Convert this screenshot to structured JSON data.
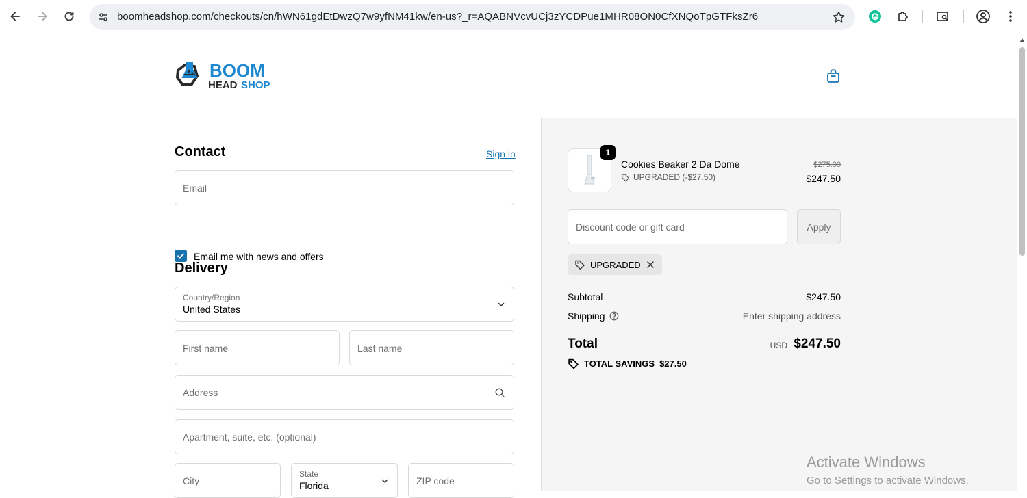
{
  "browser": {
    "url": "boomheadshop.com/checkouts/cn/hWN61gdEtDwzQ7w9yfNM41kw/en-us?_r=AQABNVcvUCj3zYCDPue1MHR08ON0CfXNQoTpGTFksZr6"
  },
  "header": {
    "logo_top": "BOOM",
    "logo_bottom_a": "HEAD",
    "logo_bottom_b": "SHOP"
  },
  "contact": {
    "heading": "Contact",
    "sign_in": "Sign in",
    "email_placeholder": "Email",
    "newsletter_label": "Email me with news and offers",
    "newsletter_checked": true
  },
  "delivery": {
    "heading": "Delivery",
    "country_label": "Country/Region",
    "country_value": "United States",
    "first_name_placeholder": "First name",
    "last_name_placeholder": "Last name",
    "address_placeholder": "Address",
    "apartment_placeholder": "Apartment, suite, etc. (optional)",
    "city_placeholder": "City",
    "state_label": "State",
    "state_value": "Florida",
    "zip_placeholder": "ZIP code"
  },
  "summary": {
    "item": {
      "quantity": "1",
      "name": "Cookies Beaker 2 Da Dome",
      "discount": "UPGRADED (-$27.50)",
      "original_price": "$275.00",
      "price": "$247.50"
    },
    "discount_placeholder": "Discount code or gift card",
    "apply_label": "Apply",
    "applied_code": "UPGRADED",
    "subtotal_label": "Subtotal",
    "subtotal_value": "$247.50",
    "shipping_label": "Shipping",
    "shipping_value": "Enter shipping address",
    "total_label": "Total",
    "currency": "USD",
    "total_value": "$247.50",
    "savings_label": "TOTAL SAVINGS",
    "savings_value": "$27.50"
  },
  "watermark": {
    "line1": "Activate Windows",
    "line2": "Go to Settings to activate Windows."
  },
  "colors": {
    "accent": "#1773b0",
    "logo_blue": "#1e88d0",
    "logo_dark": "#2b2b2b"
  }
}
